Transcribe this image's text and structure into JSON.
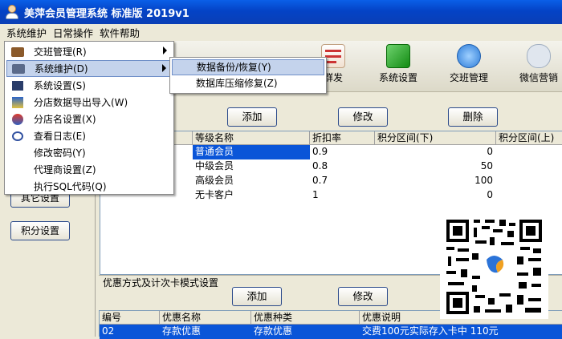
{
  "window": {
    "title": "美萍会员管理系统 标准版  2019v1"
  },
  "menubar": {
    "items": [
      "系统维护",
      "日常操作",
      "软件帮助"
    ]
  },
  "toolbar": {
    "items": [
      {
        "label": "群发",
        "icon": "sms-icon"
      },
      {
        "label": "系统设置",
        "icon": "cube-settings-icon"
      },
      {
        "label": "交班管理",
        "icon": "shift-exchange-icon"
      },
      {
        "label": "微信营销",
        "icon": "wechat-icon"
      }
    ]
  },
  "dropdown": {
    "items": [
      {
        "label": "交班管理(R)",
        "icon": "briefcase-icon",
        "submenu": true
      },
      {
        "label": "系统维护(D)",
        "icon": "maintenance-icon",
        "submenu": true
      },
      {
        "label": "系统设置(S)",
        "icon": "settings-icon",
        "submenu": false
      },
      {
        "label": "分店数据导出导入(W)",
        "icon": "data-transfer-icon",
        "submenu": false
      },
      {
        "label": "分店名设置(X)",
        "icon": "branch-icon",
        "submenu": false
      },
      {
        "label": "查看日志(E)",
        "icon": "log-icon",
        "submenu": false
      },
      {
        "label": "修改密码(Y)",
        "icon": "",
        "submenu": false
      },
      {
        "label": "代理商设置(Z)",
        "icon": "",
        "submenu": false
      },
      {
        "label": "执行SQL代码(Q)",
        "icon": "",
        "submenu": false
      }
    ]
  },
  "submenu": {
    "items": [
      "数据备份/恢复(Y)",
      "数据库压缩修复(Z)"
    ]
  },
  "left": {
    "other_settings": "其它设置",
    "points_settings": "积分设置"
  },
  "level_section": {
    "buttons": {
      "add": "添加",
      "edit": "修改",
      "delete": "删除"
    },
    "columns": [
      "等级名称",
      "折扣率",
      "积分区间(下)",
      "积分区间(上)"
    ],
    "rows": [
      [
        "普通会员",
        "0.9",
        "0",
        ""
      ],
      [
        "中级会员",
        "0.8",
        "50",
        ""
      ],
      [
        "高级会员",
        "0.7",
        "100",
        ""
      ],
      [
        "无卡客户",
        "1",
        "0",
        ""
      ]
    ]
  },
  "discount_section": {
    "title": "优惠方式及计次卡模式设置",
    "buttons": {
      "add": "添加",
      "edit": "修改"
    },
    "columns": [
      "编号",
      "优惠名称",
      "优惠种类",
      "优惠说明"
    ],
    "rows": [
      [
        "02",
        "存款优惠",
        "存款优惠",
        "交费100元实际存入卡中 110元"
      ]
    ]
  },
  "colors": {
    "title_blue": "#0443c6",
    "selection": "#0a55d8",
    "highlight": "#c4d3ec"
  }
}
